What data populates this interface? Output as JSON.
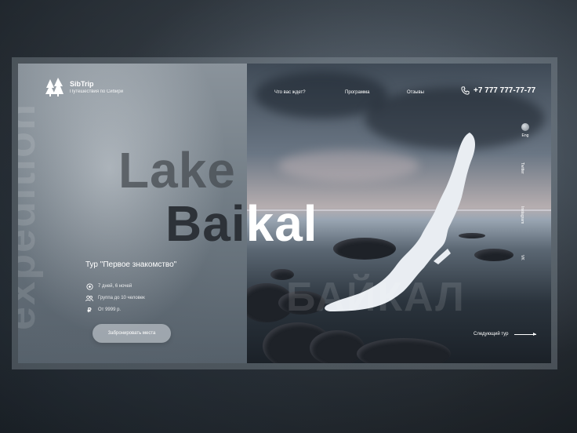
{
  "brand": {
    "name": "SibTrip",
    "tagline": "Путешествия по Сибири"
  },
  "nav": [
    "Что вас ждет?",
    "Программа",
    "Отзывы"
  ],
  "phone": "+7 777 777-77-77",
  "background_word": "expedition",
  "hero": {
    "title_line1": "Lake",
    "title_line2_a": "Ba",
    "title_line2_b": "i",
    "title_line2_c": "kal"
  },
  "tour": {
    "name": "Тур \"Первое знакомство\"",
    "duration": "7 дней, 6 ночей",
    "group": "Группа до 10 человек",
    "price": "От 9999 р."
  },
  "book_button": "Забронировать места",
  "language": "Eng",
  "social": [
    "Twitter",
    "Instagram",
    "VK"
  ],
  "cyrillic_word": "БАЙКАЛ",
  "next_tour": "Следующий тур",
  "icons": {
    "logo": "pine-trees-icon",
    "phone": "phone-icon",
    "clock": "clock-icon",
    "group": "group-icon",
    "price": "ruble-icon",
    "globe": "globe-icon",
    "arrow": "arrow-right-icon"
  }
}
